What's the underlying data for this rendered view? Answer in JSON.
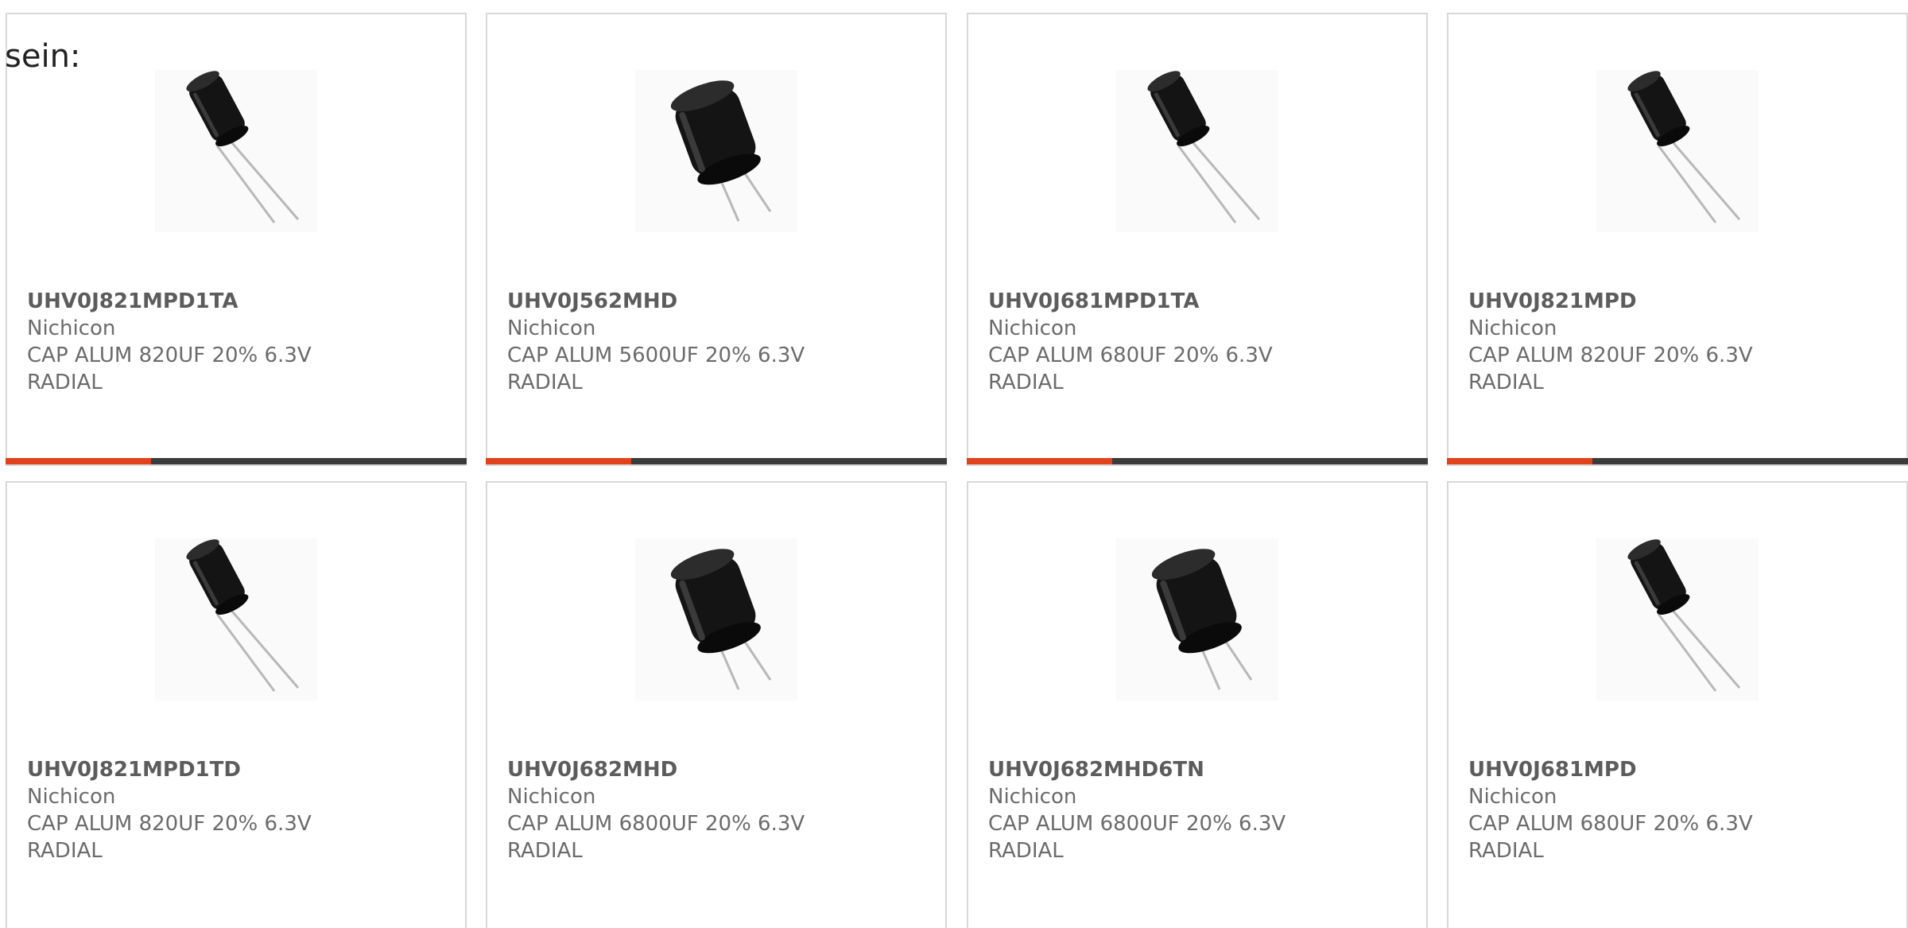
{
  "intro": "sein:",
  "accent_color": "#e0421c",
  "products": [
    {
      "part": "UHV0J821MPD1TA",
      "maker": "Nichicon",
      "desc": "CAP ALUM 820UF 20% 6.3V",
      "package": "RADIAL",
      "image": "small-radial-capacitor-icon"
    },
    {
      "part": "UHV0J562MHD",
      "maker": "Nichicon",
      "desc": "CAP ALUM 5600UF 20% 6.3V",
      "package": "RADIAL",
      "image": "large-radial-capacitor-icon"
    },
    {
      "part": "UHV0J681MPD1TA",
      "maker": "Nichicon",
      "desc": "CAP ALUM 680UF 20% 6.3V",
      "package": "RADIAL",
      "image": "small-radial-capacitor-icon"
    },
    {
      "part": "UHV0J821MPD",
      "maker": "Nichicon",
      "desc": "CAP ALUM 820UF 20% 6.3V",
      "package": "RADIAL",
      "image": "small-radial-capacitor-icon"
    },
    {
      "part": "UHV0J821MPD1TD",
      "maker": "Nichicon",
      "desc": "CAP ALUM 820UF 20% 6.3V",
      "package": "RADIAL",
      "image": "small-radial-capacitor-icon"
    },
    {
      "part": "UHV0J682MHD",
      "maker": "Nichicon",
      "desc": "CAP ALUM 6800UF 20% 6.3V",
      "package": "RADIAL",
      "image": "large-radial-capacitor-icon"
    },
    {
      "part": "UHV0J682MHD6TN",
      "maker": "Nichicon",
      "desc": "CAP ALUM 6800UF 20% 6.3V",
      "package": "RADIAL",
      "image": "large-radial-capacitor-icon"
    },
    {
      "part": "UHV0J681MPD",
      "maker": "Nichicon",
      "desc": "CAP ALUM 680UF 20% 6.3V",
      "package": "RADIAL",
      "image": "small-radial-capacitor-icon"
    }
  ]
}
